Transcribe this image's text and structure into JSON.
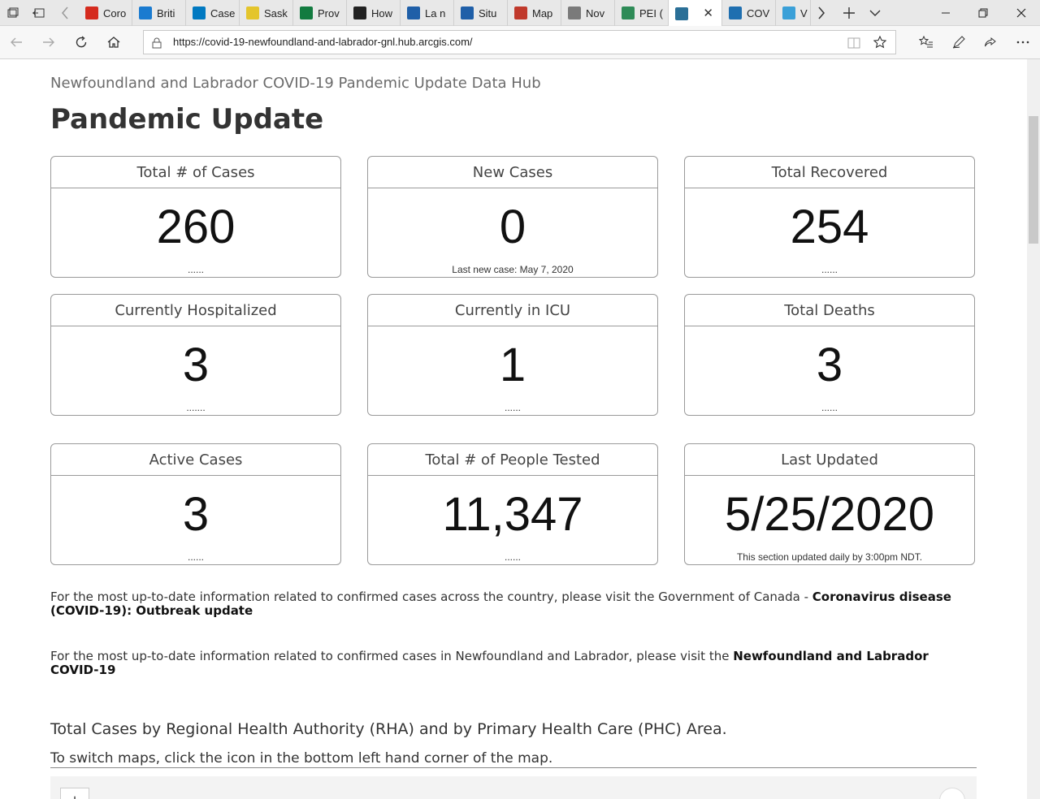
{
  "browser": {
    "tabs": [
      {
        "label": "Coro",
        "icon": "canada-flag-icon",
        "color": "#d52b1e"
      },
      {
        "label": "Briti",
        "icon": "bc-icon",
        "color": "#1a7bd0"
      },
      {
        "label": "Case",
        "icon": "alberta-icon",
        "color": "#0079c1"
      },
      {
        "label": "Sask",
        "icon": "saskatchewan-icon",
        "color": "#e4c52c"
      },
      {
        "label": "Prov",
        "icon": "manitoba-icon",
        "color": "#137b40"
      },
      {
        "label": "How",
        "icon": "ontario-icon",
        "color": "#222222"
      },
      {
        "label": "La n",
        "icon": "quebec-icon",
        "color": "#1f5fa8"
      },
      {
        "label": "Situ",
        "icon": "quebec2-icon",
        "color": "#1f5fa8"
      },
      {
        "label": "Map",
        "icon": "nb-icon",
        "color": "#c0392b"
      },
      {
        "label": "Nov",
        "icon": "ns-icon",
        "color": "#7a7a7a"
      },
      {
        "label": "PEI (",
        "icon": "pei-icon",
        "color": "#2e8b57"
      },
      {
        "label": "",
        "icon": "globe-icon",
        "color": "#2a6f97",
        "active": true
      },
      {
        "label": "COV",
        "icon": "nl-icon",
        "color": "#1f6fb0"
      },
      {
        "label": "V",
        "icon": "wave-icon",
        "color": "#3aa0d8"
      }
    ],
    "url": "https://covid-19-newfoundland-and-labrador-gnl.hub.arcgis.com/"
  },
  "page": {
    "hub_title": "Newfoundland and Labrador COVID-19 Pandemic Update Data Hub",
    "title": "Pandemic Update",
    "cards": [
      {
        "title": "Total # of Cases",
        "value": "260",
        "footer": "......"
      },
      {
        "title": "New Cases",
        "value": "0",
        "footer": "Last new case: May 7, 2020"
      },
      {
        "title": "Total Recovered",
        "value": "254",
        "footer": "......"
      },
      {
        "title": "Currently Hospitalized",
        "value": "3",
        "footer": "......."
      },
      {
        "title": "Currently in ICU",
        "value": "1",
        "footer": "......"
      },
      {
        "title": "Total Deaths",
        "value": "3",
        "footer": "......"
      },
      {
        "title": "Active Cases",
        "value": "3",
        "footer": "......"
      },
      {
        "title": "Total # of People Tested",
        "value": "11,347",
        "footer": "......"
      },
      {
        "title": "Last Updated",
        "value": "5/25/2020",
        "footer": "This section updated daily by 3:00pm NDT."
      }
    ],
    "para1_text": "For the most up-to-date information related to confirmed cases across the country, please visit the Government of Canada - ",
    "para1_link": "Coronavirus disease (COVID-19): Outbreak update",
    "para2_text": "For the most up-to-date information related to confirmed cases in Newfoundland and Labrador, please visit the ",
    "para2_link": "Newfoundland and Labrador COVID-19",
    "section_title": "Total Cases by Regional Health Authority (RHA) and by Primary Health Care (PHC) Area.",
    "section_sub": "To switch maps, click the icon in the bottom left hand corner of the map.",
    "map_zoom_in": "+"
  }
}
